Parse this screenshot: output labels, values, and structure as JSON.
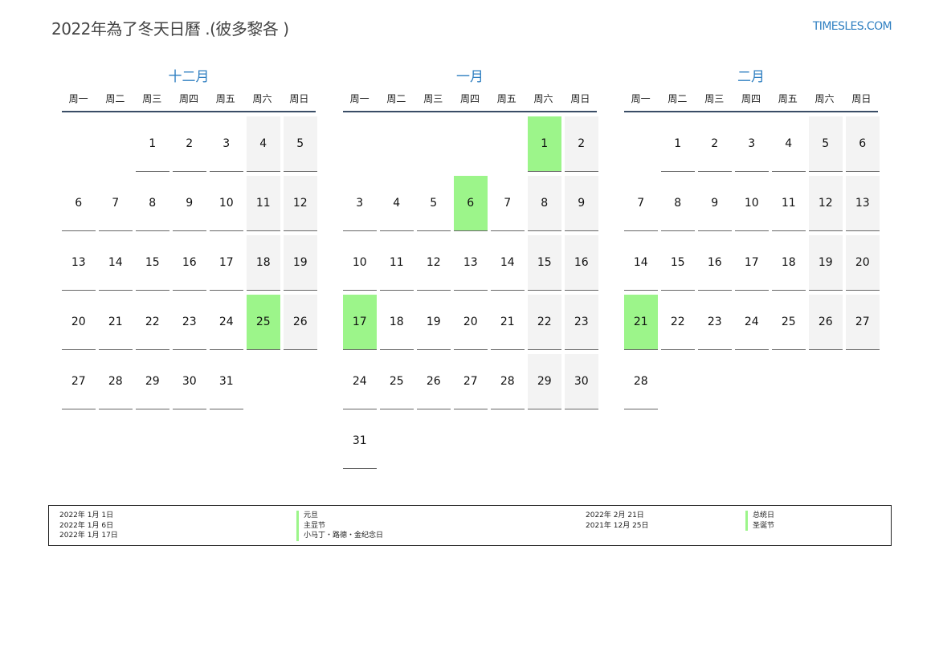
{
  "title": "2022年為了冬天日曆 .(彼多黎各 )",
  "site": "TIMESLES.COM",
  "weekdays": [
    "周一",
    "周二",
    "周三",
    "周四",
    "周五",
    "周六",
    "周日"
  ],
  "colors": {
    "accent": "#2f7fc1",
    "holiday": "#9cf58a",
    "weekend": "#f3f3f3",
    "rule": "#3a4d66"
  },
  "months": [
    {
      "name": "十二月",
      "offset": 2,
      "days": 31,
      "holidays": [
        25
      ]
    },
    {
      "name": "一月",
      "offset": 5,
      "days": 31,
      "holidays": [
        1,
        6,
        17
      ]
    },
    {
      "name": "二月",
      "offset": 1,
      "days": 28,
      "holidays": [
        21
      ]
    }
  ],
  "legend": {
    "left_dates": [
      "2022年 1月 1日",
      "2022年 1月 6日",
      "2022年 1月 17日"
    ],
    "left_names": [
      "元旦",
      "主显节",
      "小马丁・路德・金纪念日"
    ],
    "right_dates": [
      "2022年 2月 21日",
      "2021年 12月 25日"
    ],
    "right_names": [
      "总统日",
      "圣诞节"
    ]
  }
}
